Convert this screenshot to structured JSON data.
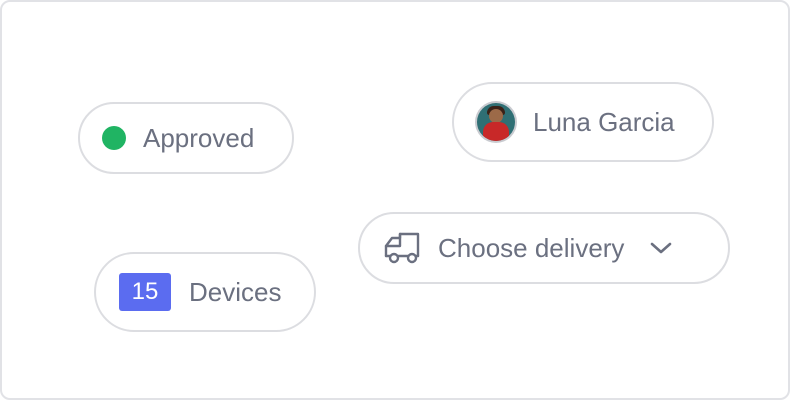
{
  "chips": {
    "status": {
      "label": "Approved",
      "dot_color": "#20b463"
    },
    "user": {
      "name": "Luna Garcia",
      "avatar_icon": "user-avatar"
    },
    "delivery": {
      "label": "Choose delivery",
      "icon": "truck-icon",
      "dropdown_icon": "chevron-down-icon"
    },
    "devices": {
      "count": "15",
      "label": "Devices",
      "badge_color": "#5b6cf0"
    }
  }
}
